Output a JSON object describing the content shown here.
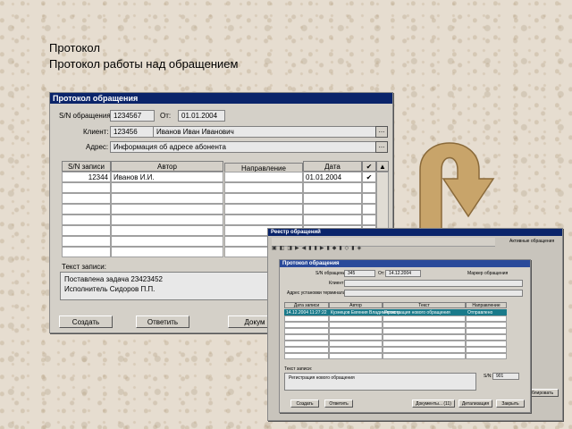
{
  "heading": {
    "line1": "Протокол",
    "line2": "Протокол работы над обращением"
  },
  "main_window": {
    "title": "Протокол обращения",
    "sn_label": "S/N обращения:",
    "sn_value": "1234567",
    "from_label": "От:",
    "from_value": "01.01.2004",
    "client_label": "Клиент:",
    "client_id": "123456",
    "client_name": "Иванов Иван Иванович",
    "address_label": "Адрес:",
    "address_value": "Информация об адресе абонента",
    "dots": "...",
    "columns": [
      "S/N записи",
      "Автор",
      "Направление",
      "Дата"
    ],
    "rows": [
      {
        "sn": "12344",
        "author": "Иванов И.И.",
        "direction": "",
        "date": "01.01.2004",
        "checked": true
      },
      {
        "sn": "",
        "author": "",
        "direction": "",
        "date": "",
        "checked": false
      },
      {
        "sn": "",
        "author": "",
        "direction": "",
        "date": "",
        "checked": false
      },
      {
        "sn": "",
        "author": "",
        "direction": "",
        "date": "",
        "checked": false
      },
      {
        "sn": "",
        "author": "",
        "direction": "",
        "date": "",
        "checked": false
      },
      {
        "sn": "",
        "author": "",
        "direction": "",
        "date": "",
        "checked": false
      },
      {
        "sn": "",
        "author": "",
        "direction": "",
        "date": "",
        "checked": false
      },
      {
        "sn": "",
        "author": "",
        "direction": "",
        "date": "",
        "checked": false
      }
    ],
    "note_label": "Текст записи:",
    "note_line1": "Поставлена задача 23423452",
    "note_line2": "Исполнитель Сидоров П.П.",
    "buttons": {
      "create": "Создать",
      "reply": "Ответить",
      "documents": "Докум"
    }
  },
  "arrow_color": "#c8a46a",
  "mini_app": {
    "bg_title": "Реестр обращений",
    "active_label": "Активные обращения",
    "window_title": "Протокол обращения",
    "sn_label": "S/N обращения:",
    "sn_value": "345",
    "from_label": "От:",
    "from_value": "14.12.2004",
    "marker_label": "Маркер обращения",
    "client_label": "Клиент:",
    "address_label": "Адрес установки терминала:",
    "columns": [
      "Дата записи",
      "Автор",
      "Текст",
      "Направление"
    ],
    "row1": {
      "date": "14.12.2004 11:27:22",
      "author": "Кузнецов Евгения Владимировна",
      "text": "Регистрация нового обращения",
      "direction": "Отправлено"
    },
    "note_label": "Текст записи:",
    "note_text": "Регистрация нового обращения",
    "sn_small_label": "S/N:",
    "sn_small_value": "901",
    "buttons": {
      "create": "Создать",
      "reply": "Ответить",
      "docs": "Документы... (11)",
      "details": "Детализация",
      "close": "Закрыть"
    },
    "bg_button": "Дублировать"
  }
}
